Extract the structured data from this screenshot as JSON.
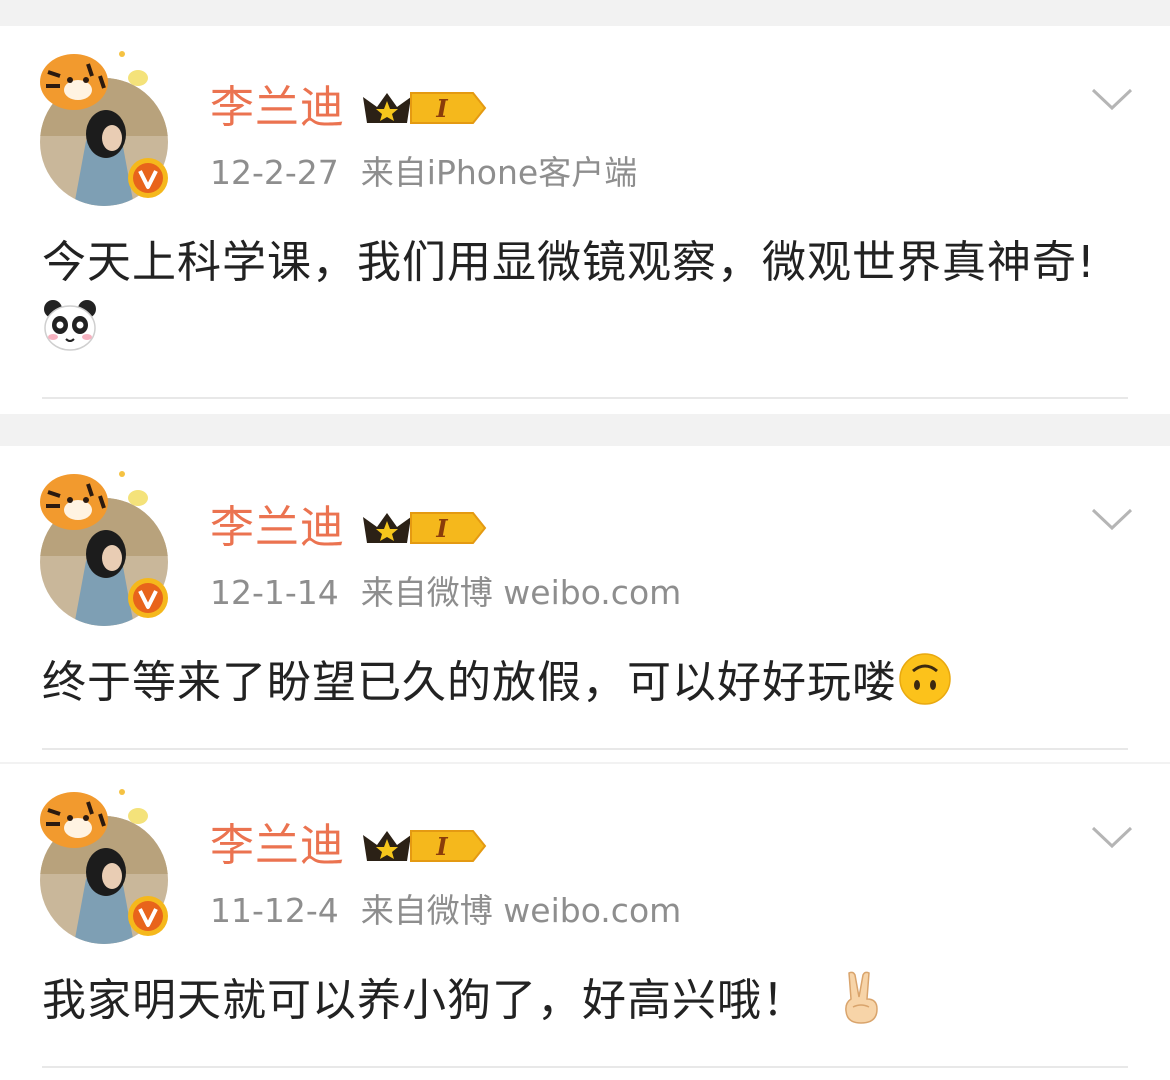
{
  "posts": [
    {
      "username": "李兰迪",
      "vip_level": "I",
      "date": "12-2-27",
      "source": "来自iPhone客户端",
      "text": "今天上科学课，我们用显微镜观察，微观世界真神奇!",
      "emoji": "panda-emoji",
      "menu_icon": "chevron-down-icon"
    },
    {
      "username": "李兰迪",
      "vip_level": "I",
      "date": "12-1-14",
      "source": "来自微博 weibo.com",
      "text": "终于等来了盼望已久的放假，可以好好玩喽",
      "emoji": "upside-down-face-emoji",
      "menu_icon": "chevron-down-icon"
    },
    {
      "username": "李兰迪",
      "vip_level": "I",
      "date": "11-12-4",
      "source": "来自微博 weibo.com",
      "text": "我家明天就可以养小狗了，好高兴哦！",
      "emoji": "victory-hand-emoji",
      "menu_icon": "chevron-down-icon"
    }
  ],
  "colors": {
    "username": "#eb7350",
    "meta": "#8e8e8e",
    "text": "#222222",
    "verified": "#e8641b",
    "vip_gold": "#f5b81c",
    "background": "#f2f2f2"
  }
}
